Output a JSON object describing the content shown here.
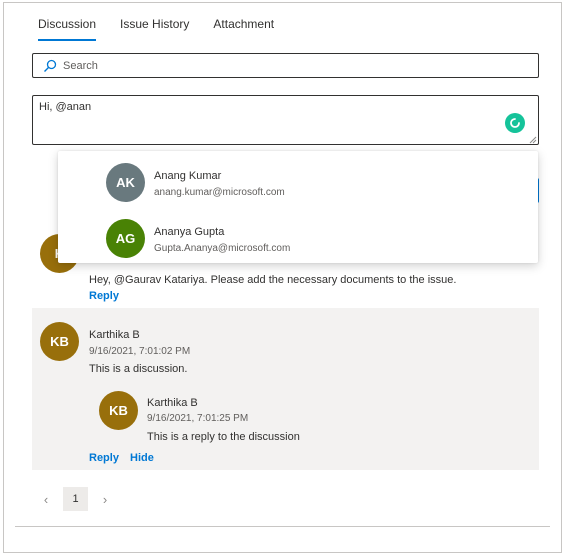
{
  "tabs": [
    {
      "label": "Discussion",
      "active": true
    },
    {
      "label": "Issue History",
      "active": false
    },
    {
      "label": "Attachment",
      "active": false
    }
  ],
  "search": {
    "placeholder": "Search",
    "icon": "search-icon"
  },
  "composer": {
    "text": "Hi, @anan",
    "icon": "grammar-check-icon"
  },
  "mention_suggestions": [
    {
      "initials": "AK",
      "name": "Anang Kumar",
      "email": "anang.kumar@microsoft.com",
      "color": "#69797e"
    },
    {
      "initials": "AG",
      "name": "Ananya Gupta",
      "email": "Gupta.Ananya@microsoft.com",
      "color": "#498205"
    }
  ],
  "discussions": [
    {
      "initials": "K",
      "color": "#986f0b",
      "message": "Hey, @Gaurav Katariya. Please add the necessary documents to the issue.",
      "reply_label": "Reply"
    },
    {
      "initials": "KB",
      "color": "#986f0b",
      "name": "Karthika B",
      "time": "9/16/2021, 7:01:02 PM",
      "message": "This is a discussion.",
      "reply": {
        "initials": "KB",
        "color": "#986f0b",
        "name": "Karthika B",
        "time": "9/16/2021, 7:01:25 PM",
        "message": "This is a reply to the discussion"
      },
      "reply_label": "Reply",
      "hide_label": "Hide"
    }
  ],
  "pagination": {
    "prev": "‹",
    "current": "1",
    "next": "›"
  }
}
